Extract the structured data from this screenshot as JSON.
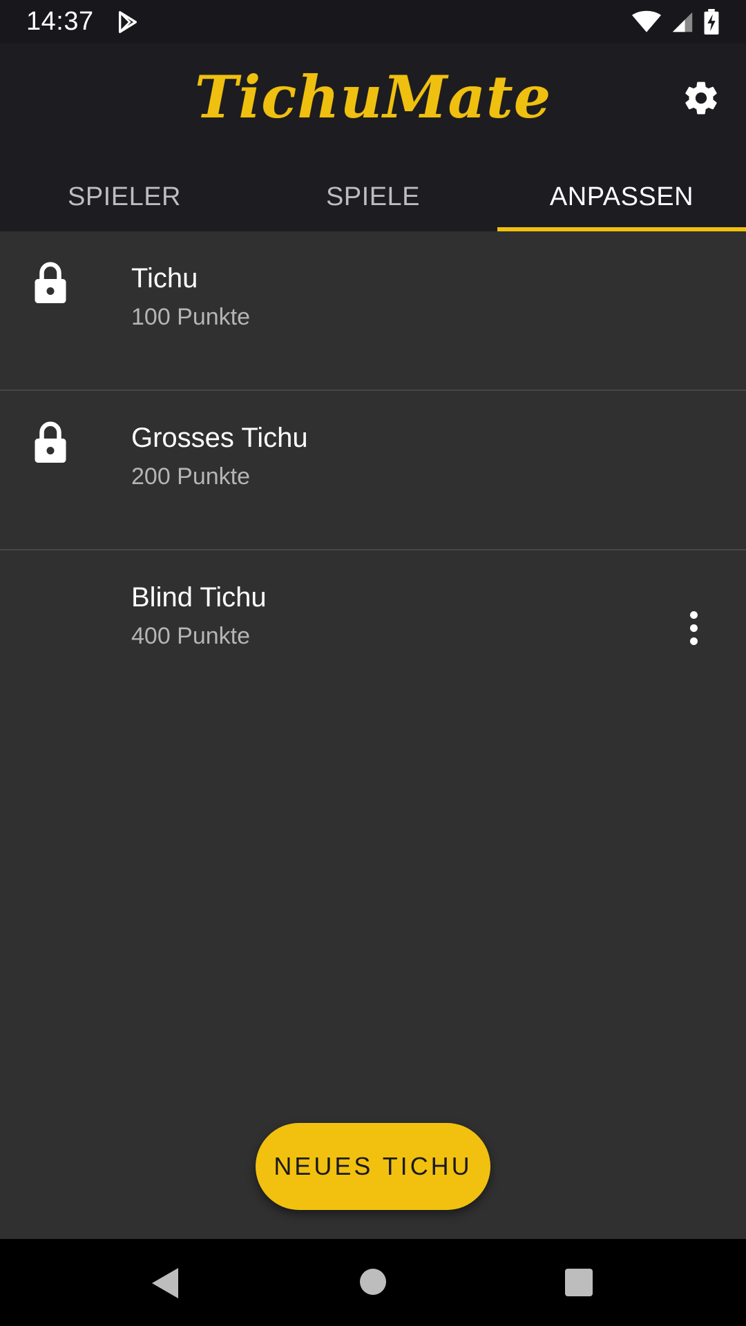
{
  "status_bar": {
    "time": "14:37",
    "icons": [
      "play-store-icon",
      "wifi-icon",
      "cellular-signal-icon",
      "battery-charging-icon"
    ]
  },
  "app_bar": {
    "logo_text": "TichuMate",
    "settings_icon": "gear-icon"
  },
  "tabs": [
    {
      "label": "SPIELER",
      "active": false
    },
    {
      "label": "SPIELE",
      "active": false
    },
    {
      "label": "ANPASSEN",
      "active": true
    }
  ],
  "list": {
    "items": [
      {
        "title": "Tichu",
        "subtitle": "100 Punkte",
        "icon": "lock-icon"
      },
      {
        "title": "Grosses Tichu",
        "subtitle": "200 Punkte",
        "icon": "lock-icon"
      },
      {
        "title": "Blind Tichu",
        "subtitle": "400 Punkte",
        "icon": "more-vert-icon"
      }
    ]
  },
  "fab": {
    "label": "NEUES TICHU"
  },
  "colors": {
    "accent": "#f2c10f",
    "background": "#303030",
    "app_bar": "#1c1c21",
    "status_bar": "#17171c"
  }
}
